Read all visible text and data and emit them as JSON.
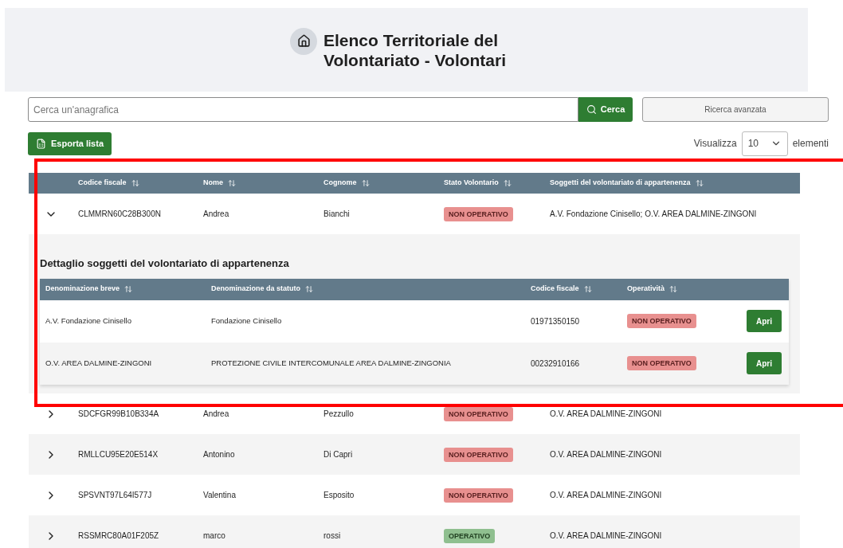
{
  "page_title": "Elenco Territoriale del Volontariato - Volontari",
  "search": {
    "placeholder": "Cerca un'anagrafica",
    "button": "Cerca",
    "advanced": "Ricerca avanzata"
  },
  "export_button": "Esporta lista",
  "page_size": {
    "label": "Visualizza",
    "value": "10",
    "suffix": "elementi"
  },
  "table": {
    "columns": [
      "Codice fiscale",
      "Nome",
      "Cognome",
      "Stato Volontario",
      "Soggetti del volontariato di appartenenza"
    ],
    "rows": [
      {
        "expanded": true,
        "codice_fiscale": "CLMMRN60C28B300N",
        "nome": "Andrea",
        "cognome": "Bianchi",
        "stato": {
          "label": "NON OPERATIVO",
          "kind": "non_operativo"
        },
        "soggetti": "A.V. Fondazione Cinisello; O.V. AREA DALMINE-ZINGONI",
        "detail": {
          "title": "Dettaglio soggetti del volontariato di appartenenza",
          "columns": [
            "Denominazione breve",
            "Denominazione da statuto",
            "Codice fiscale",
            "Operatività"
          ],
          "rows": [
            {
              "breve": "A.V. Fondazione Cinisello",
              "statuto": "Fondazione Cinisello",
              "codice_fiscale": "01971350150",
              "operativita": {
                "label": "NON OPERATIVO",
                "kind": "non_operativo"
              },
              "button": "Apri"
            },
            {
              "breve": "O.V. AREA DALMINE-ZINGONI",
              "statuto": "PROTEZIONE CIVILE INTERCOMUNALE AREA DALMINE-ZINGONIA",
              "codice_fiscale": "00232910166",
              "operativita": {
                "label": "NON OPERATIVO",
                "kind": "non_operativo"
              },
              "button": "Apri"
            }
          ]
        }
      },
      {
        "expanded": false,
        "codice_fiscale": "SDCFGR99B10B334A",
        "nome": "Andrea",
        "cognome": "Pezzullo",
        "stato": {
          "label": "NON OPERATIVO",
          "kind": "non_operativo"
        },
        "soggetti": "O.V. AREA DALMINE-ZINGONI"
      },
      {
        "expanded": false,
        "codice_fiscale": "RMLLCU95E20E514X",
        "nome": "Antonino",
        "cognome": "Di Capri",
        "stato": {
          "label": "NON OPERATIVO",
          "kind": "non_operativo"
        },
        "soggetti": "O.V. AREA DALMINE-ZINGONI"
      },
      {
        "expanded": false,
        "codice_fiscale": "SPSVNT97L64I577J",
        "nome": "Valentina",
        "cognome": "Esposito",
        "stato": {
          "label": "NON OPERATIVO",
          "kind": "non_operativo"
        },
        "soggetti": "O.V. AREA DALMINE-ZINGONI"
      },
      {
        "expanded": false,
        "codice_fiscale": "RSSMRC80A01F205Z",
        "nome": "marco",
        "cognome": "rossi",
        "stato": {
          "label": "OPERATIVO",
          "kind": "operativo"
        },
        "soggetti": "O.V. AREA DALMINE-ZINGONI"
      }
    ]
  }
}
